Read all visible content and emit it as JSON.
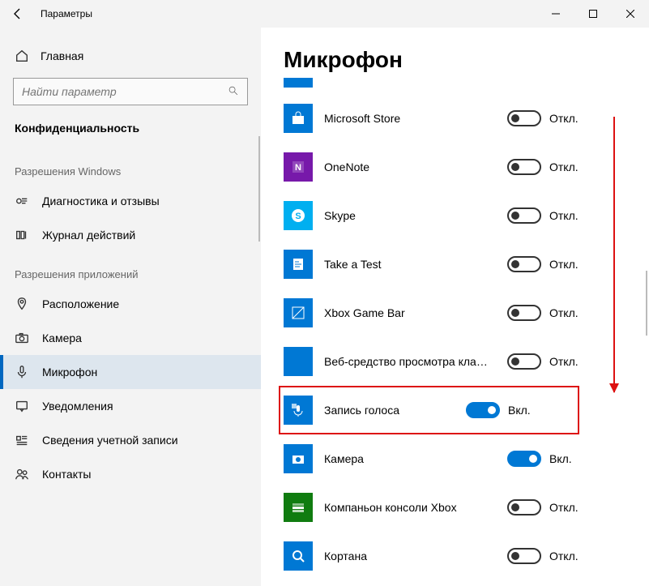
{
  "titlebar": {
    "title": "Параметры"
  },
  "sidebar": {
    "home": "Главная",
    "search_placeholder": "Найти параметр",
    "category": "Конфиденциальность",
    "section_windows": "Разрешения Windows",
    "section_apps": "Разрешения приложений",
    "nav_windows": [
      {
        "icon": "feedback",
        "label": "Диагностика и отзывы"
      },
      {
        "icon": "history",
        "label": "Журнал действий"
      }
    ],
    "nav_apps": [
      {
        "icon": "location",
        "label": "Расположение"
      },
      {
        "icon": "camera",
        "label": "Камера"
      },
      {
        "icon": "mic",
        "label": "Микрофон",
        "active": true
      },
      {
        "icon": "notify",
        "label": "Уведомления"
      },
      {
        "icon": "account",
        "label": "Сведения учетной записи"
      },
      {
        "icon": "contacts",
        "label": "Контакты"
      }
    ]
  },
  "content": {
    "heading": "Микрофон",
    "state_on": "Вкл.",
    "state_off": "Откл.",
    "apps": [
      {
        "name": "Microsoft Store",
        "on": false,
        "color": "#0078d4",
        "icon": "store"
      },
      {
        "name": "OneNote",
        "on": false,
        "color": "#7719aa",
        "icon": "onenote"
      },
      {
        "name": "Skype",
        "on": false,
        "color": "#00aff0",
        "icon": "skype"
      },
      {
        "name": "Take a Test",
        "on": false,
        "color": "#0078d4",
        "icon": "test"
      },
      {
        "name": "Xbox Game Bar",
        "on": false,
        "color": "#0078d4",
        "icon": "xbox"
      },
      {
        "name": "Веб-средство просмотра класси...",
        "on": false,
        "color": "#0078d4",
        "icon": "blank"
      },
      {
        "name": "Запись голоса",
        "on": true,
        "color": "#0078d4",
        "icon": "voice",
        "highlight": true
      },
      {
        "name": "Камера",
        "on": true,
        "color": "#0078d4",
        "icon": "camera"
      },
      {
        "name": "Компаньон консоли Xbox",
        "on": false,
        "color": "#107c10",
        "icon": "xboxc"
      },
      {
        "name": "Кортана",
        "on": false,
        "color": "#0078d4",
        "icon": "search"
      }
    ]
  }
}
